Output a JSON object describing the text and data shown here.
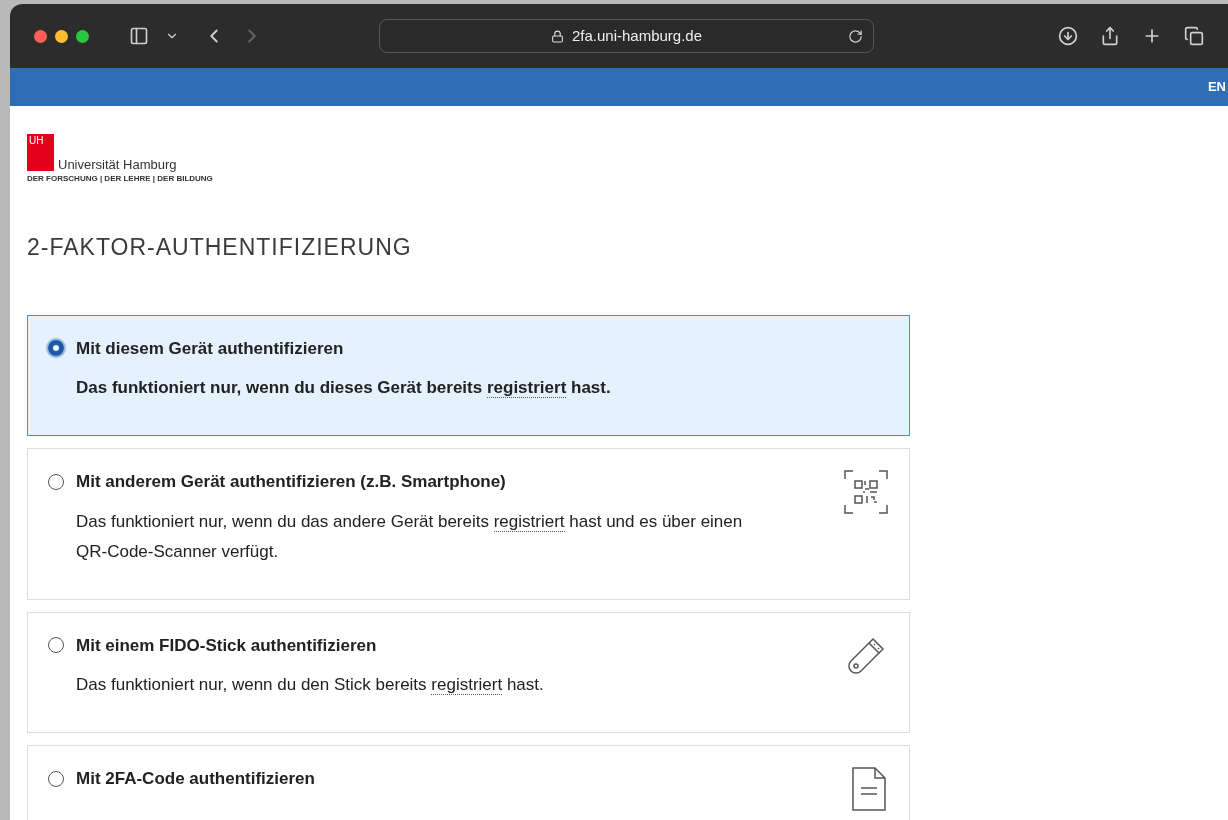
{
  "browser": {
    "url": "2fa.uni-hamburg.de"
  },
  "top_bar": {
    "language": "EN"
  },
  "logo": {
    "mark": "UH",
    "name": "Universität Hamburg",
    "tagline": "DER FORSCHUNG | DER LEHRE | DER BILDUNG"
  },
  "heading": "2-FAKTOR-AUTHENTIFIZIERUNG",
  "options": [
    {
      "title": "Mit diesem Gerät authentifizieren",
      "selected": true,
      "kind": "device",
      "description": {
        "before": "Das funktioniert nur, wenn du dieses Gerät bereits ",
        "term": "registriert",
        "after": " hast."
      }
    },
    {
      "title": "Mit anderem Gerät authentifizieren (z.B. Smartphone)",
      "selected": false,
      "kind": "qr",
      "description": {
        "before": "Das funktioniert nur, wenn du das andere Gerät bereits ",
        "term": "registriert",
        "after": " hast und es über einen QR-Code-Scanner verfügt."
      }
    },
    {
      "title": "Mit einem FIDO-Stick authentifizieren",
      "selected": false,
      "kind": "usb",
      "description": {
        "before": "Das funktioniert nur, wenn du den Stick bereits ",
        "term": "registriert",
        "after": " hast."
      }
    },
    {
      "title": "Mit 2FA-Code authentifizieren",
      "selected": false,
      "kind": "document"
    }
  ]
}
